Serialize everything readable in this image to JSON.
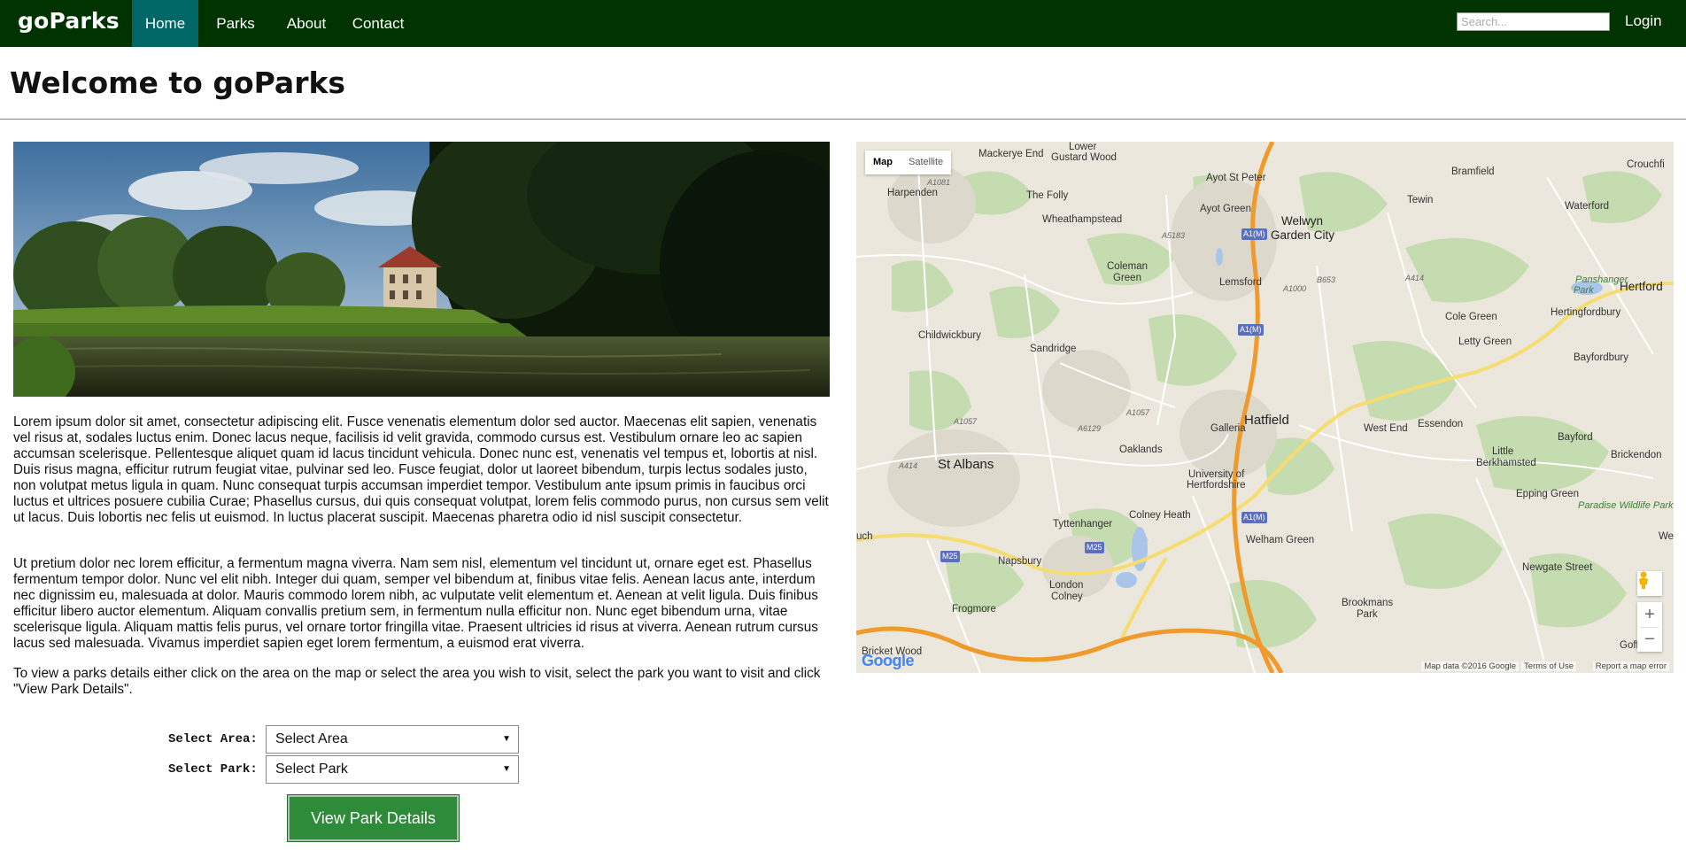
{
  "nav": {
    "brand": "goParks",
    "items": [
      {
        "label": "Home",
        "active": true
      },
      {
        "label": "Parks",
        "active": false
      },
      {
        "label": "About",
        "active": false
      },
      {
        "label": "Contact",
        "active": false
      }
    ],
    "search_placeholder": "Search...",
    "login": "Login"
  },
  "page": {
    "title": "Welcome to goParks"
  },
  "content": {
    "paragraph1": "Lorem ipsum dolor sit amet, consectetur adipiscing elit. Fusce venenatis elementum dolor sed auctor. Maecenas elit sapien, venenatis vel risus at, sodales luctus enim. Donec lacus neque, facilisis id velit gravida, commodo cursus est. Vestibulum ornare leo ac sapien accumsan scelerisque. Pellentesque aliquet quam id lacus tincidunt vehicula. Donec nunc est, venenatis vel tempus et, lobortis at nisl. Duis risus magna, efficitur rutrum feugiat vitae, pulvinar sed leo. Fusce feugiat, dolor ut laoreet bibendum, turpis lectus sodales justo, non volutpat metus ligula in quam. Nunc consequat turpis accumsan imperdiet tempor. Vestibulum ante ipsum primis in faucibus orci luctus et ultrices posuere cubilia Curae; Phasellus cursus, dui quis consequat volutpat, lorem felis commodo purus, non cursus sem velit ut lacus. Duis lobortis nec felis ut euismod. In luctus placerat suscipit. Maecenas pharetra odio id nisl suscipit consectetur.",
    "paragraph2": "Ut pretium dolor nec lorem efficitur, a fermentum magna viverra. Nam sem nisl, elementum vel tincidunt ut, ornare eget est. Phasellus fermentum tempor dolor. Nunc vel elit nibh. Integer dui quam, semper vel bibendum at, finibus vitae felis. Aenean lacus ante, interdum nec dignissim eu, malesuada at dolor. Mauris commodo lorem nibh, ac vulputate velit elementum et. Aenean at velit ligula. Duis finibus efficitur libero auctor elementum. Aliquam convallis pretium sem, in fermentum nulla efficitur non. Nunc eget bibendum urna, vitae scelerisque ligula. Aliquam mattis felis purus, vel ornare tortor fringilla vitae. Praesent ultricies id risus at viverra. Aenean rutrum cursus lacus sed malesuada. Vivamus imperdiet sapien eget lorem fermentum, a euismod erat viverra.",
    "paragraph3": "To view a parks details either click on the area on the map or select the area you wish to visit, select the park you want to visit and click \"View Park Details\"."
  },
  "form": {
    "area_label": "Select Area:",
    "area_value": "Select Area",
    "park_label": "Select Park:",
    "park_value": "Select Park",
    "submit": "View Park Details"
  },
  "map": {
    "type_map": "Map",
    "type_satellite": "Satellite",
    "zoom_in": "+",
    "zoom_out": "−",
    "google": "Google",
    "attribution_data": "Map data ©2016 Google",
    "attribution_terms": "Terms of Use",
    "attribution_report": "Report a map error",
    "places": [
      "Mackerye End",
      "Lower",
      "Gustard Wood",
      "Ayot St Peter",
      "Bramfield",
      "Crouchfi",
      "Harpenden",
      "The Folly",
      "Ayot Green",
      "Tewin",
      "Waterford",
      "Wheathampstead",
      "Welwyn",
      "Garden City",
      "Coleman",
      "Green",
      "Lemsford",
      "Panshanger",
      "Park",
      "Hertford",
      "Cole Green",
      "Hertingfordbury",
      "Childwickbury",
      "Sandridge",
      "Letty Green",
      "Bayfordbury",
      "Hatfield",
      "Galleria",
      "West End",
      "Essendon",
      "St Albans",
      "Oaklands",
      "University of",
      "Hertfordshire",
      "Little",
      "Berkhamsted",
      "Bayford",
      "Brickendon",
      "Epping Green",
      "Paradise Wildlife Park",
      "Tyttenhanger",
      "Colney Heath",
      "uch",
      "Wes",
      "Welham Green",
      "Napsbury",
      "London",
      "Colney",
      "Newgate Street",
      "Frogmore",
      "Brookmans",
      "Park",
      "Goff's Oa",
      "Bricket Wood"
    ],
    "roads": [
      "A1(M)",
      "A1(M)",
      "A1(M)",
      "A414",
      "A414",
      "M25",
      "M25",
      "A1081",
      "A1057",
      "A5183",
      "B653",
      "A1000",
      "A6129",
      "A1057"
    ]
  }
}
